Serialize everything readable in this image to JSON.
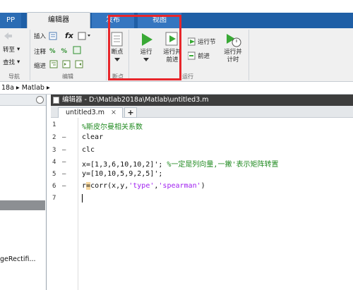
{
  "tabs": {
    "app": "PP",
    "editor": "编辑器",
    "publish": "发布",
    "view": "视图"
  },
  "ribbon": {
    "nav": {
      "goto": "转至",
      "find": "查找",
      "label": "导航"
    },
    "edit": {
      "insert": "插入",
      "fx": "fx",
      "comment": "注释",
      "indent": "缩进",
      "label": "编辑"
    },
    "breakpoints": {
      "button": "断点",
      "label": "断点"
    },
    "run": {
      "run": "运行",
      "run_advance": "运行并\n前进",
      "run_section": "运行节",
      "advance": "前进",
      "run_and_time": "运行并\n计时",
      "label": "运行"
    }
  },
  "address": {
    "path": "18a ▸ Matlab ▸"
  },
  "left_panel": {
    "file_entry": "geRectifi..."
  },
  "editor": {
    "title": "编辑器 - D:\\Matlab2018a\\Matlab\\untitled3.m",
    "file_tab": "untitled3.m",
    "close": "×",
    "add": "+",
    "lines": [
      {
        "num": "1",
        "dash": "",
        "code": "%斯皮尔曼相关系数"
      },
      {
        "num": "2",
        "dash": "—",
        "code": "clear"
      },
      {
        "num": "3",
        "dash": "—",
        "code": "clc"
      },
      {
        "num": "4",
        "dash": "—",
        "code_a": "x=[1,3,6,10,10,2]';",
        "code_b": " %一定是列向量,一撇'表示矩阵转置"
      },
      {
        "num": "5",
        "dash": "—",
        "code": "y=[10,10,5,9,2,5]';"
      },
      {
        "num": "6",
        "dash": "—",
        "code_a": "r",
        "code_b": "=",
        "code_c": "corr(x,y,",
        "code_d": "'type'",
        "code_e": ",",
        "code_f": "'spearman'",
        "code_g": ")"
      },
      {
        "num": "7",
        "dash": "",
        "code": ""
      }
    ]
  },
  "colors": {
    "tab_blue": "#1f5fa6",
    "highlight_box": "#e8262b",
    "comment_green": "#228b22",
    "string_purple": "#a020f0"
  }
}
